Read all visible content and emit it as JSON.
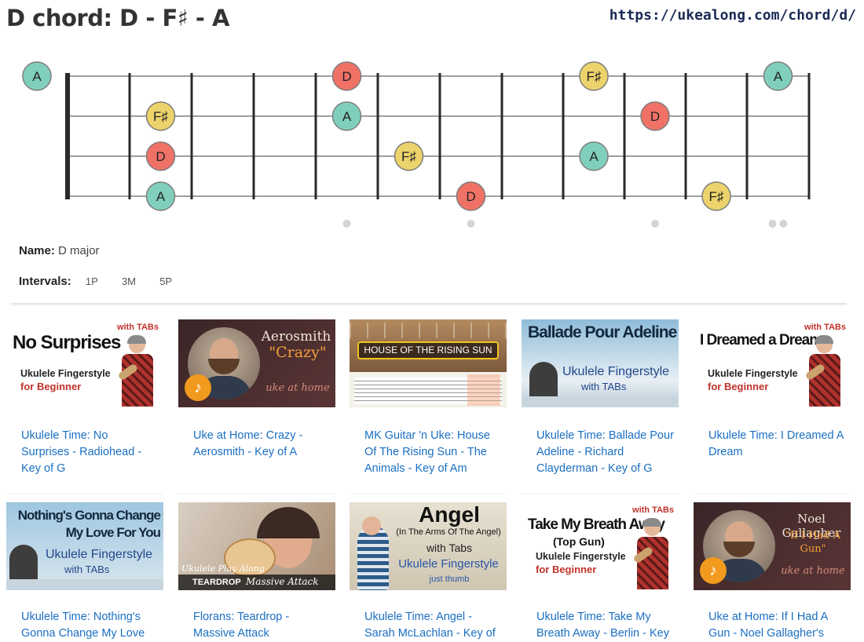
{
  "title": "D chord: D - F♯ - A",
  "url": "https://ukealong.com/chord/d/",
  "info": {
    "name_label": "Name:",
    "name_value": "D major",
    "intervals_label": "Intervals:",
    "intervals": [
      "1P",
      "3M",
      "5P"
    ]
  },
  "colors": {
    "root": "#f07266",
    "third": "#ecd36b",
    "fifth": "#80cfbc",
    "link": "#1a6fc2"
  },
  "fretboard": {
    "strings": 4,
    "frets": 12,
    "inlay_frets": [
      5,
      7,
      10,
      12
    ],
    "notes": [
      {
        "string": 1,
        "fret": 0,
        "label": "A",
        "role": "fifth"
      },
      {
        "string": 1,
        "fret": 5,
        "label": "D",
        "role": "root"
      },
      {
        "string": 1,
        "fret": 9,
        "label": "F♯",
        "role": "third"
      },
      {
        "string": 1,
        "fret": 12,
        "label": "A",
        "role": "fifth"
      },
      {
        "string": 2,
        "fret": 2,
        "label": "F♯",
        "role": "third"
      },
      {
        "string": 2,
        "fret": 5,
        "label": "A",
        "role": "fifth"
      },
      {
        "string": 2,
        "fret": 10,
        "label": "D",
        "role": "root"
      },
      {
        "string": 3,
        "fret": 2,
        "label": "D",
        "role": "root"
      },
      {
        "string": 3,
        "fret": 6,
        "label": "F♯",
        "role": "third"
      },
      {
        "string": 3,
        "fret": 9,
        "label": "A",
        "role": "fifth"
      },
      {
        "string": 4,
        "fret": 2,
        "label": "A",
        "role": "fifth"
      },
      {
        "string": 4,
        "fret": 7,
        "label": "D",
        "role": "root"
      },
      {
        "string": 4,
        "fret": 11,
        "label": "F♯",
        "role": "third"
      }
    ]
  },
  "videos": [
    {
      "title": "Ukulele Time: No Surprises - Radiohead - Key of G",
      "thumb": {
        "style": "white-tabs",
        "head": "No Surprises",
        "sub1": "Ukulele Fingerstyle",
        "sub2": "for Beginner",
        "badge": "with TABs"
      }
    },
    {
      "title": "Uke at Home: Crazy - Aerosmith - Key of A",
      "thumb": {
        "style": "dark-home",
        "head": "Aerosmith",
        "sub1": "\"Crazy\"",
        "sub2": "uke at home"
      }
    },
    {
      "title": "MK Guitar 'n Uke: House Of The Rising Sun - The Animals - Key of Am",
      "thumb": {
        "style": "rising",
        "head": "HOUSE OF THE RISING SUN"
      }
    },
    {
      "title": "Ukulele Time: Ballade Pour Adeline - Richard Clayderman - Key of G",
      "thumb": {
        "style": "sky",
        "head": "Ballade Pour Adeline",
        "sub1": "Ukulele Fingerstyle",
        "sub2": "with TABs"
      }
    },
    {
      "title": "Ukulele Time: I Dreamed A Dream",
      "thumb": {
        "style": "white-tabs",
        "head": "I Dreamed a Dream",
        "sub1": "Ukulele Fingerstyle",
        "sub2": "for Beginner",
        "badge": "with TABs"
      }
    },
    {
      "title": "Ukulele Time: Nothing's Gonna Change My Love",
      "thumb": {
        "style": "sky2",
        "head": "Nothing's Gonna Change",
        "head2": "My Love For You",
        "sub1": "Ukulele Fingerstyle",
        "sub2": "with TABs"
      }
    },
    {
      "title": "Florans: Teardrop - Massive Attack",
      "thumb": {
        "style": "teardrop",
        "head": "Ukulele Play Along",
        "sub1": "TEARDROP",
        "sub2": "Massive Attack"
      }
    },
    {
      "title": "Ukulele Time: Angel - Sarah McLachlan - Key of",
      "thumb": {
        "style": "angel",
        "head": "Angel",
        "sub1": "(In The Arms Of The Angel)",
        "sub2": "with Tabs",
        "sub3": "Ukulele Fingerstyle",
        "sub4": "just thumb"
      }
    },
    {
      "title": "Ukulele Time: Take My Breath Away - Berlin - Key",
      "thumb": {
        "style": "white-tabs",
        "head": "Take My Breath Away",
        "head2": "(Top Gun)",
        "sub1": "Ukulele Fingerstyle",
        "sub2": "for Beginner",
        "badge": "with TABs"
      }
    },
    {
      "title": "Uke at Home: If I Had A Gun - Noel Gallagher's",
      "thumb": {
        "style": "dark-home",
        "head": "Noel Gallagher",
        "sub1": "\"If I Had A Gun\"",
        "sub2": "uke at home"
      }
    }
  ]
}
